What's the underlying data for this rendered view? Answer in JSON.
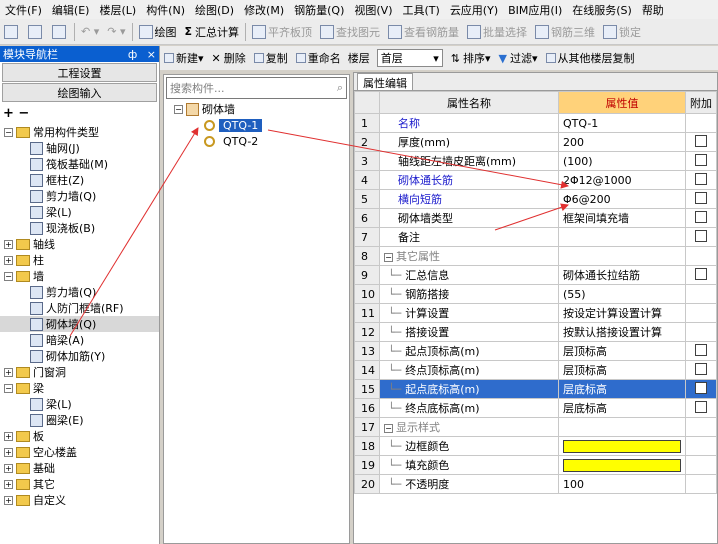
{
  "menu": [
    "文件(F)",
    "编辑(E)",
    "楼层(L)",
    "构件(N)",
    "绘图(D)",
    "修改(M)",
    "钢筋量(Q)",
    "视图(V)",
    "工具(T)",
    "云应用(Y)",
    "BIM应用(I)",
    "在线服务(S)",
    "帮助"
  ],
  "toolbar": {
    "draw": "绘图",
    "sum": "汇总计算",
    "flush": "平齐板顶",
    "find": "查找图元",
    "view_rebar": "查看钢筋量",
    "batch_select": "批量选择",
    "rebar3d": "钢筋三维",
    "lock": "锁定"
  },
  "toolbar2": {
    "new": "新建",
    "delete": "删除",
    "copy": "复制",
    "rename": "重命名",
    "floor_label": "楼层",
    "floor_value": "首层",
    "sort": "排序",
    "filter": "过滤",
    "copy_from": "从其他楼层复制"
  },
  "nav": {
    "title": "模块导航栏",
    "pin": "ф",
    "close": "×",
    "btn1": "工程设置",
    "btn2": "绘图输入",
    "tools": "+  −",
    "tree": [
      {
        "label": "常用构件类型",
        "level": 0,
        "type": "folder",
        "exp": "−"
      },
      {
        "label": "轴网(J)",
        "level": 1,
        "type": "leaf"
      },
      {
        "label": "筏板基础(M)",
        "level": 1,
        "type": "leaf"
      },
      {
        "label": "框柱(Z)",
        "level": 1,
        "type": "leaf"
      },
      {
        "label": "剪力墙(Q)",
        "level": 1,
        "type": "leaf"
      },
      {
        "label": "梁(L)",
        "level": 1,
        "type": "leaf"
      },
      {
        "label": "现浇板(B)",
        "level": 1,
        "type": "leaf"
      },
      {
        "label": "轴线",
        "level": 0,
        "type": "folder",
        "exp": "+"
      },
      {
        "label": "柱",
        "level": 0,
        "type": "folder",
        "exp": "+"
      },
      {
        "label": "墙",
        "level": 0,
        "type": "folder",
        "exp": "−"
      },
      {
        "label": "剪力墙(Q)",
        "level": 1,
        "type": "leaf"
      },
      {
        "label": "人防门框墙(RF)",
        "level": 1,
        "type": "leaf"
      },
      {
        "label": "砌体墙(Q)",
        "level": 1,
        "type": "leaf",
        "selected": true
      },
      {
        "label": "暗梁(A)",
        "level": 1,
        "type": "leaf"
      },
      {
        "label": "砌体加筋(Y)",
        "level": 1,
        "type": "leaf"
      },
      {
        "label": "门窗洞",
        "level": 0,
        "type": "folder",
        "exp": "+"
      },
      {
        "label": "梁",
        "level": 0,
        "type": "folder",
        "exp": "−"
      },
      {
        "label": "梁(L)",
        "level": 1,
        "type": "leaf"
      },
      {
        "label": "圈梁(E)",
        "level": 1,
        "type": "leaf"
      },
      {
        "label": "板",
        "level": 0,
        "type": "folder",
        "exp": "+"
      },
      {
        "label": "空心楼盖",
        "level": 0,
        "type": "folder",
        "exp": "+"
      },
      {
        "label": "基础",
        "level": 0,
        "type": "folder",
        "exp": "+"
      },
      {
        "label": "其它",
        "level": 0,
        "type": "folder",
        "exp": "+"
      },
      {
        "label": "自定义",
        "level": 0,
        "type": "folder",
        "exp": "+"
      }
    ]
  },
  "components": {
    "search_placeholder": "搜索构件...",
    "root": "砌体墙",
    "items": [
      {
        "label": "QTQ-1",
        "selected": true
      },
      {
        "label": "QTQ-2",
        "selected": false
      }
    ]
  },
  "props": {
    "tab": "属性编辑",
    "col_name": "属性名称",
    "col_value": "属性值",
    "col_extra": "附加",
    "rows": [
      {
        "n": "1",
        "name": "名称",
        "value": "QTQ-1",
        "blue": true,
        "cb": false
      },
      {
        "n": "2",
        "name": "厚度(mm)",
        "value": "200",
        "cb": true
      },
      {
        "n": "3",
        "name": "轴线距左墙皮距离(mm)",
        "value": "(100)",
        "cb": true
      },
      {
        "n": "4",
        "name": "砌体通长筋",
        "value": "2Φ12@1000",
        "blue": true,
        "cb": true
      },
      {
        "n": "5",
        "name": "横向短筋",
        "value": "Φ6@200",
        "blue": true,
        "cb": true
      },
      {
        "n": "6",
        "name": "砌体墙类型",
        "value": "框架间填充墙",
        "cb": true
      },
      {
        "n": "7",
        "name": "备注",
        "value": "",
        "cb": true
      },
      {
        "n": "8",
        "name": "其它属性",
        "value": "",
        "group": true
      },
      {
        "n": "9",
        "name": "汇总信息",
        "value": "砌体通长拉结筋",
        "sub": true,
        "cb": true
      },
      {
        "n": "10",
        "name": "钢筋搭接",
        "value": "(55)",
        "sub": true,
        "cb": false
      },
      {
        "n": "11",
        "name": "计算设置",
        "value": "按设定计算设置计算",
        "sub": true
      },
      {
        "n": "12",
        "name": "搭接设置",
        "value": "按默认搭接设置计算",
        "sub": true
      },
      {
        "n": "13",
        "name": "起点顶标高(m)",
        "value": "层顶标高",
        "sub": true,
        "cb": true
      },
      {
        "n": "14",
        "name": "终点顶标高(m)",
        "value": "层顶标高",
        "sub": true,
        "cb": true
      },
      {
        "n": "15",
        "name": "起点底标高(m)",
        "value": "层底标高",
        "sub": true,
        "cb": true,
        "selected": true
      },
      {
        "n": "16",
        "name": "终点底标高(m)",
        "value": "层底标高",
        "sub": true,
        "cb": true
      },
      {
        "n": "17",
        "name": "显示样式",
        "value": "",
        "group": true
      },
      {
        "n": "18",
        "name": "边框颜色",
        "value": "",
        "sub": true,
        "swatch": true
      },
      {
        "n": "19",
        "name": "填充颜色",
        "value": "",
        "sub": true,
        "swatch": true
      },
      {
        "n": "20",
        "name": "不透明度",
        "value": "100",
        "sub": true
      }
    ]
  },
  "colors": {
    "title_blue": "#0a5fd0",
    "selection": "#2f6ccc",
    "arrow": "#e03030",
    "swatch": "#ffff00",
    "header_value": "#ffd27a"
  }
}
